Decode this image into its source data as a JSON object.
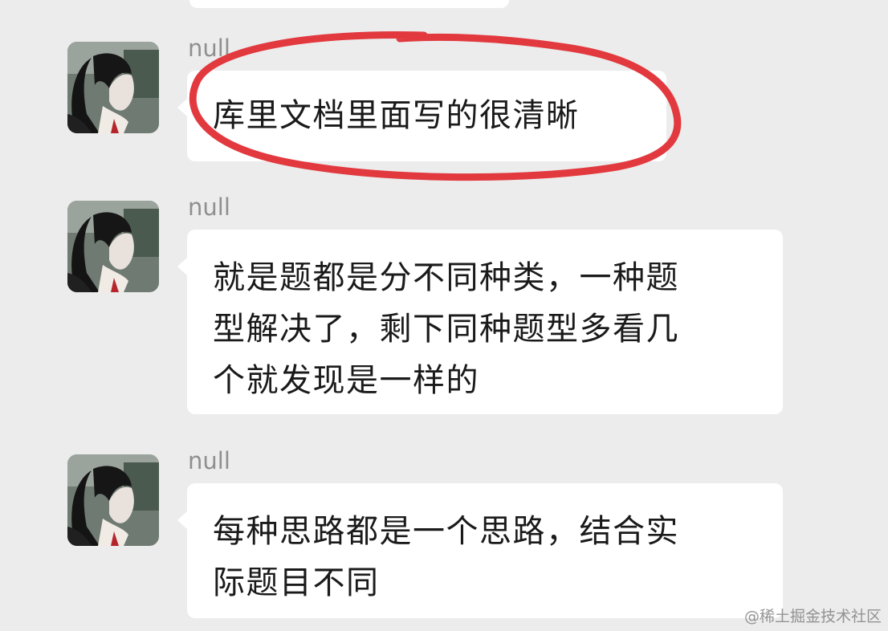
{
  "messages": [
    {
      "sender": "null",
      "text": "库里文档里面写的很清晰",
      "highlighted": true
    },
    {
      "sender": "null",
      "text": "就是题都是分不同种类，一种题\n型解决了，剩下同种题型多看几\n个就发现是一样的",
      "highlighted": false
    },
    {
      "sender": "null",
      "text": "每种思路都是一个思路，结合实\n际题目不同",
      "highlighted": false
    }
  ],
  "watermark": "@稀土掘金技术社区",
  "colors": {
    "background": "#ececec",
    "bubble": "#ffffff",
    "annotation_circle": "#e2393f",
    "sender_name": "#8f8f8f"
  },
  "icons": {
    "avatar": "user-avatar"
  }
}
